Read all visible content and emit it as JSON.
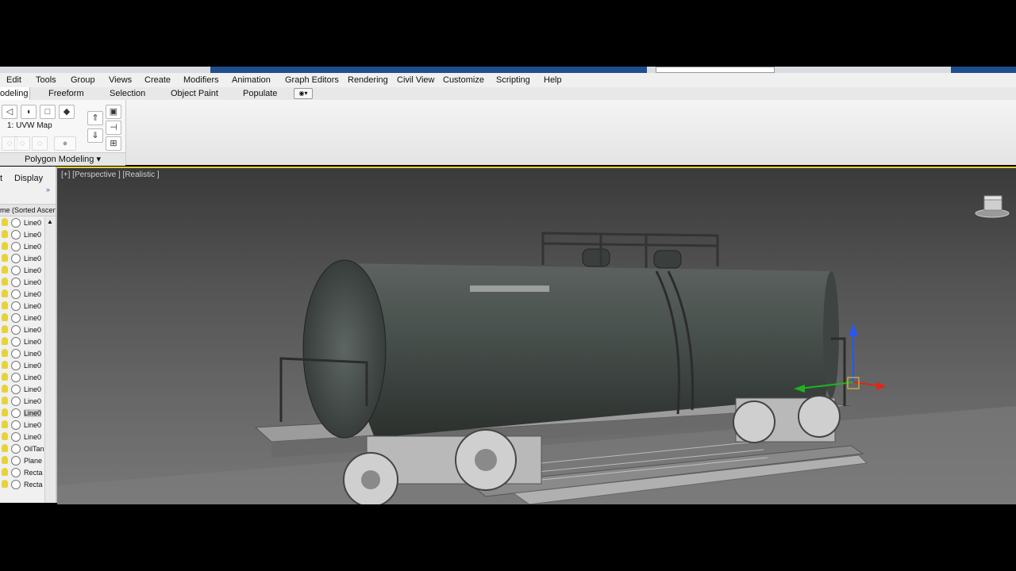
{
  "menu": {
    "items": [
      "Edit",
      "Tools",
      "Group",
      "Views",
      "Create",
      "Modifiers",
      "Animation",
      "Graph Editors",
      "Rendering",
      "Civil View",
      "Customize",
      "Scripting",
      "Help"
    ]
  },
  "ribbon": {
    "tabs": [
      "odeling",
      "Freeform",
      "Selection",
      "Object Paint",
      "Populate"
    ],
    "modifier_label": "1: UVW Map",
    "panel_label": "Polygon Modeling"
  },
  "command_panel": {
    "tab_partial": "t",
    "tab_display": "Display",
    "sort_header": "me (Sorted Ascen",
    "objects": [
      "Line0",
      "Line0",
      "Line0",
      "Line0",
      "Line0",
      "Line0",
      "Line0",
      "Line0",
      "Line0",
      "Line0",
      "Line0",
      "Line0",
      "Line0",
      "Line0",
      "Line0",
      "Line0",
      "Line0",
      "Line0",
      "Line0",
      "OilTan",
      "Plane",
      "Recta",
      "Recta"
    ]
  },
  "viewport": {
    "label": "[+] [Perspective ] [Realistic ]"
  },
  "colors": {
    "accent_yellow": "#e8d23a",
    "title_blue": "#1e4f8c"
  }
}
